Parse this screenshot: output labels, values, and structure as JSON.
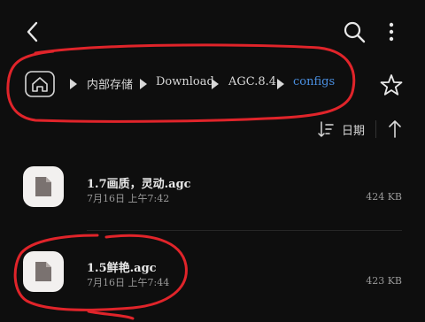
{
  "topbar": {
    "back_icon": "chevron-left-icon",
    "search_icon": "search-icon",
    "more_icon": "more-vertical-icon"
  },
  "breadcrumb": {
    "home_icon": "home-icon",
    "items": [
      {
        "label": "内部存储"
      },
      {
        "label": "Download"
      },
      {
        "label": "AGC.8.4"
      },
      {
        "label": "configs"
      }
    ],
    "active_color": "#4a8fe0",
    "favorite_icon": "star-icon"
  },
  "sort": {
    "label": "日期",
    "icon": "sort-icon",
    "direction_icon": "arrow-up-icon"
  },
  "files": [
    {
      "name": "1.7画质，灵动.agc",
      "date": "7月16日 上午7:42",
      "size": "424 KB",
      "icon": "file-icon"
    },
    {
      "name": "1.5鲜艳.agc",
      "date": "7月16日 上午7:44",
      "size": "423 KB",
      "icon": "file-icon"
    }
  ],
  "annotation_color": "#e0242a"
}
